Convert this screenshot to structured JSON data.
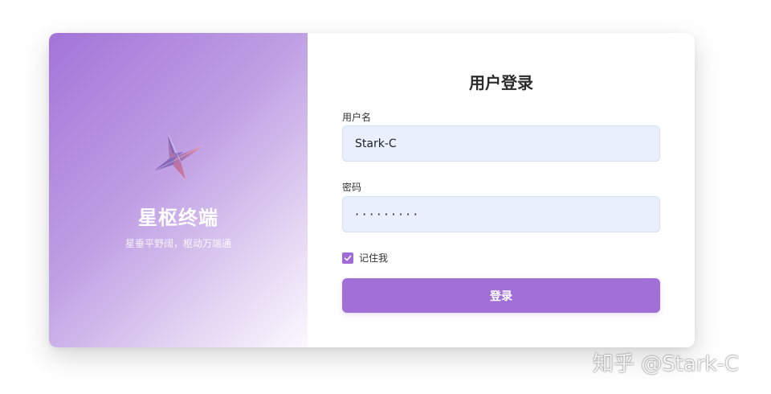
{
  "brand": {
    "title": "星枢终端",
    "subtitle": "星垂平野阔，枢动万端通",
    "logo_icon": "star-logo-icon"
  },
  "login": {
    "title": "用户登录",
    "username_label": "用户名",
    "username_value": "Stark-C",
    "password_label": "密码",
    "password_value": "·········",
    "remember_label": "记住我",
    "remember_checked": true,
    "submit_label": "登录"
  },
  "watermark": "知乎 @Stark-C",
  "colors": {
    "accent": "#a070d7",
    "input_bg": "#e8effd",
    "panel_gradient_start": "#a374d8",
    "panel_gradient_end": "#fbf8fe"
  }
}
